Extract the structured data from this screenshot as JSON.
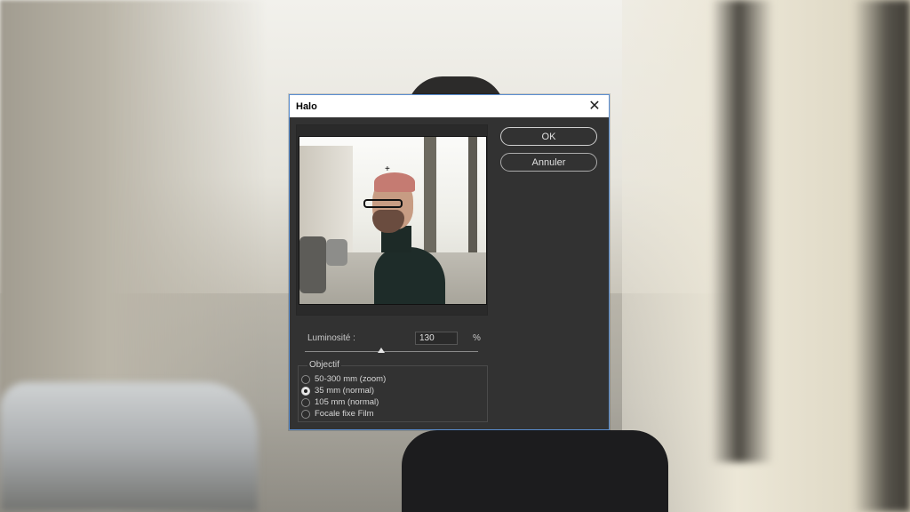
{
  "dialog": {
    "title": "Halo",
    "close_glyph": "✕"
  },
  "buttons": {
    "ok": "OK",
    "cancel": "Annuler"
  },
  "brightness": {
    "label": "Luminosité :",
    "value": "130",
    "unit": "%",
    "slider_fraction": 0.44
  },
  "lens": {
    "title": "Objectif",
    "options": [
      {
        "label": "50-300 mm (zoom)",
        "selected": false
      },
      {
        "label": "35 mm (normal)",
        "selected": true
      },
      {
        "label": "105 mm  (normal)",
        "selected": false
      },
      {
        "label": "Focale fixe Film",
        "selected": false
      }
    ]
  },
  "preview": {
    "crosshair_glyph": "+"
  },
  "colors": {
    "dialog_bg": "#323232",
    "accent_border": "#5a8ed0"
  }
}
